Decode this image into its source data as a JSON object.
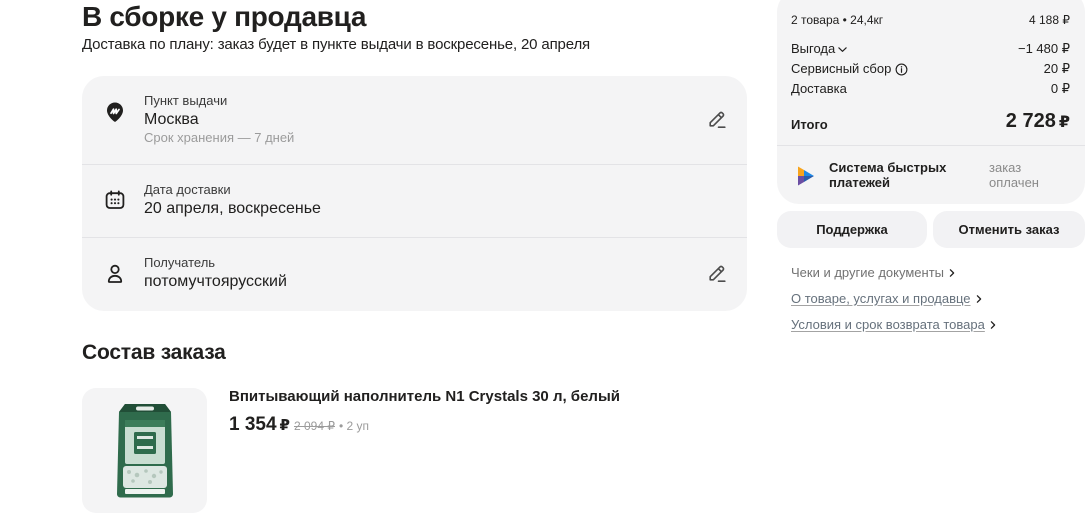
{
  "header": {
    "title": "В сборке у продавца",
    "subtitle": "Доставка по плану: заказ будет в пункте выдачи в воскресенье, 20 апреля"
  },
  "delivery": {
    "pickup": {
      "icon": "pickup-point-icon",
      "label": "Пункт выдачи",
      "value": "Москва",
      "note": "Срок хранения — 7 дней",
      "edit_icon": "pencil-icon"
    },
    "date": {
      "icon": "calendar-icon",
      "label": "Дата доставки",
      "value": "20 апреля, воскресенье"
    },
    "recipient": {
      "icon": "person-icon",
      "label": "Получатель",
      "value": "потомучтоярусский",
      "edit_icon": "pencil-icon"
    }
  },
  "order": {
    "title": "Состав заказа",
    "items": [
      {
        "image_icon": "cat-litter-bag-icon",
        "name": "Впитывающий наполнитель N1 Crystals 30 л, белый",
        "price": "1 354",
        "currency": "₽",
        "old_price": "2 094 ₽",
        "quantity": "• 2 уп"
      }
    ]
  },
  "summary": {
    "rows": [
      {
        "label": "2 товара • 24,4кг",
        "value": "4 188 ₽"
      },
      {
        "label": "Выгода",
        "value": "−1 480 ₽",
        "icon": "chevron-down-icon"
      },
      {
        "label": "Сервисный сбор",
        "value": "20 ₽",
        "icon": "info-icon"
      },
      {
        "label": "Доставка",
        "value": "0 ₽"
      }
    ],
    "total": {
      "label": "Итого",
      "value": "2 728",
      "currency": "₽"
    },
    "payment": {
      "icon": "sbp-logo-icon",
      "method": "Система быстрых платежей",
      "status": "заказ оплачен"
    }
  },
  "actions": {
    "support": "Поддержка",
    "cancel": "Отменить заказ"
  },
  "links": [
    {
      "label": "Чеки и другие документы",
      "icon": "chevron-right-icon"
    },
    {
      "label": "О товаре, услугах и продавце",
      "icon": "chevron-right-icon"
    },
    {
      "label": "Условия и срок возврата товара",
      "icon": "chevron-right-icon"
    }
  ],
  "colors": {
    "text": "#21201f",
    "muted": "#8a8a8a",
    "surface": "#f4f4f5"
  }
}
